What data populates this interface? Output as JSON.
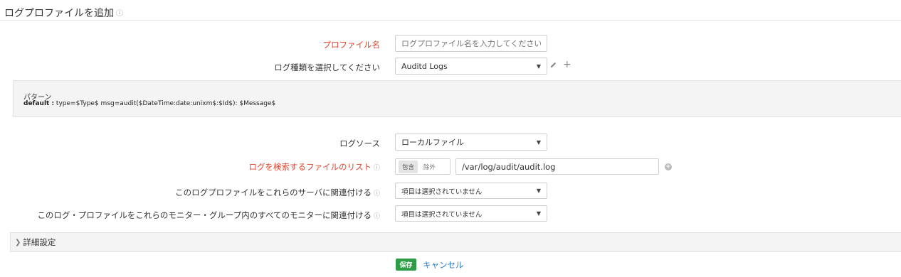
{
  "page": {
    "title": "ログプロファイルを追加",
    "title_info": "ⓘ"
  },
  "form": {
    "profile_name": {
      "label": "プロファイル名",
      "placeholder": "ログプロファイル名を入力してください",
      "value": ""
    },
    "log_type": {
      "label": "ログ種類を選択してください",
      "value": "Auditd Logs"
    },
    "pattern": {
      "label": "パターン",
      "key": "default :",
      "value": " type=$Type$ msg=audit($DateTime:date:unixm$:$Id$): $Message$"
    },
    "log_source": {
      "label": "ログソース",
      "value": "ローカルファイル"
    },
    "file_list": {
      "label": "ログを検索するファイルのリスト",
      "info": "ⓘ",
      "include_label": "包含",
      "exclude_label": "除外",
      "value": "/var/log/audit/audit.log"
    },
    "associate_servers": {
      "label": "このログプロファイルをこれらのサーバに関連付ける",
      "info": "ⓘ",
      "value": "項目は選択されていません"
    },
    "associate_monitors": {
      "label": "このログ・プロファイルをこれらのモニター・グループ内のすべてのモニターに関連付ける",
      "info": "ⓘ",
      "value": "項目は選択されていません"
    }
  },
  "advanced": {
    "label": "詳細設定"
  },
  "actions": {
    "save_label": "保存",
    "cancel_label": "キャンセル"
  },
  "colors": {
    "required_label": "#e0452c",
    "save_button": "#2e9c47",
    "link": "#2a7ac7"
  },
  "icons": [
    "info-icon",
    "chevron-down-icon",
    "edit-pencil-icon",
    "add-plus-icon",
    "add-circle-icon",
    "chevron-right-icon"
  ]
}
